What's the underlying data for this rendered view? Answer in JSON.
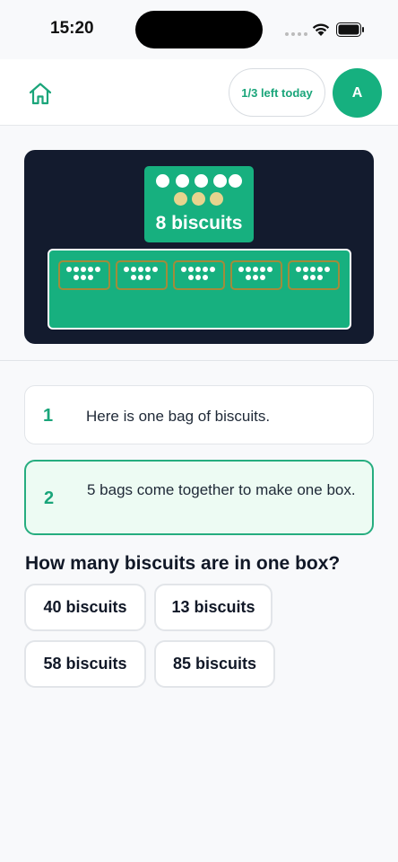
{
  "status_bar": {
    "time": "15:20"
  },
  "header": {
    "home_icon": "home-icon",
    "left_today": "1/3 left today",
    "avatar_initial": "A"
  },
  "illustration": {
    "bag_label": "8 biscuits",
    "bag_white_dots": 5,
    "bag_cream_dots": 3,
    "box_bags": 5,
    "colors": {
      "background": "#131b2e",
      "green": "#17b07f",
      "cream": "#e8d48e",
      "bag_outline": "#a38b3a"
    }
  },
  "steps": [
    {
      "number": "1",
      "text": "Here is one bag of biscuits."
    },
    {
      "number": "2",
      "text": "5 bags come together to make one box."
    }
  ],
  "question": "How many biscuits are in one box?",
  "answers": [
    "40 biscuits",
    "13 biscuits",
    "58 biscuits",
    "85 biscuits"
  ],
  "colors": {
    "accent": "#1aa57a",
    "highlight_bg": "#edfbf3",
    "highlight_border": "#26ad7f"
  }
}
